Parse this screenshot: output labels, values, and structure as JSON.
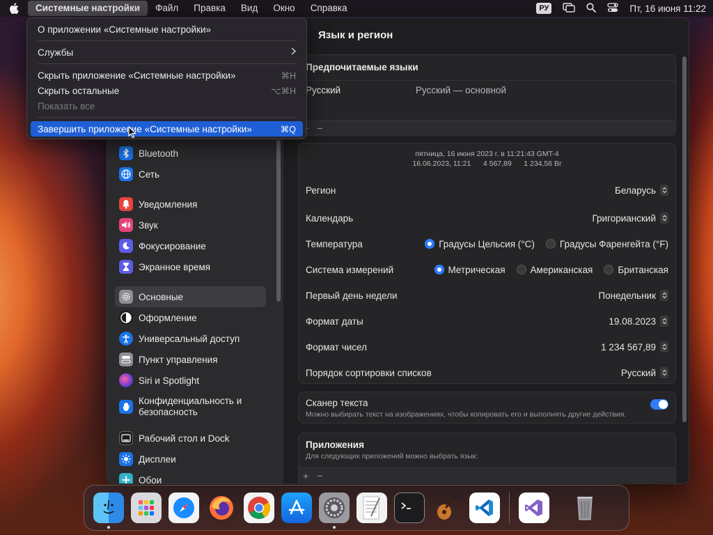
{
  "menubar": {
    "app_name": "Системные настройки",
    "items": [
      "Файл",
      "Правка",
      "Вид",
      "Окно",
      "Справка"
    ],
    "input_source": "РУ",
    "clock": "Пт, 16 июня  11:22"
  },
  "app_menu": {
    "about": "О приложении «Системные настройки»",
    "services": "Службы",
    "hide": "Скрыть приложение «Системные настройки»",
    "hide_shortcut": "⌘H",
    "hide_others": "Скрыть остальные",
    "hide_others_shortcut": "⌥⌘H",
    "show_all": "Показать все",
    "quit": "Завершить приложение «Системные настройки»",
    "quit_shortcut": "⌘Q"
  },
  "sidebar": {
    "items": [
      {
        "label": "Bluetooth",
        "icon": "bluetooth-icon",
        "color": "#1a73e8"
      },
      {
        "label": "Сеть",
        "icon": "globe-icon",
        "color": "#1a73e8"
      },
      {
        "label": "Уведомления",
        "icon": "bell-icon",
        "color": "#e5443f"
      },
      {
        "label": "Звук",
        "icon": "speaker-icon",
        "color": "#e5447a"
      },
      {
        "label": "Фокусирование",
        "icon": "moon-icon",
        "color": "#5e5ce6"
      },
      {
        "label": "Экранное время",
        "icon": "hourglass-icon",
        "color": "#5e5ce6"
      },
      {
        "label": "Основные",
        "icon": "gear-icon",
        "color": "#8e8e93"
      },
      {
        "label": "Оформление",
        "icon": "appearance-icon",
        "color": "#1c1c1e"
      },
      {
        "label": "Универсальный доступ",
        "icon": "accessibility-icon",
        "color": "#1a73e8"
      },
      {
        "label": "Пункт управления",
        "icon": "control-center-icon",
        "color": "#8e8e93"
      },
      {
        "label": "Siri и Spotlight",
        "icon": "siri-icon",
        "color": "#6b3fd4"
      },
      {
        "label": "Конфиденциальность и безопасность",
        "icon": "hand-icon",
        "color": "#1a73e8"
      },
      {
        "label": "Рабочий стол и Dock",
        "icon": "dock-icon",
        "color": "#1c1c1e"
      },
      {
        "label": "Дисплеи",
        "icon": "sun-icon",
        "color": "#1a73e8"
      },
      {
        "label": "Обои",
        "icon": "wallpaper-icon",
        "color": "#30b0c7"
      }
    ]
  },
  "content": {
    "title": "Язык и регион",
    "preferred_languages": {
      "title": "Предпочитаемые языки",
      "language": "Русский",
      "language_detail": "Русский — основной"
    },
    "preview": {
      "line1": "пятница, 16 июня 2023 г. в 11:21:43 GMT-4",
      "line2": "16.06.2023, 11:21      4 567,89      1 234,56 Br"
    },
    "region_label": "Регион",
    "region_value": "Беларусь",
    "calendar_label": "Календарь",
    "calendar_value": "Григорианский",
    "temperature_label": "Температура",
    "temperature_celsius": "Градусы Цельсия (°C)",
    "temperature_fahrenheit": "Градусы Фаренгейта (°F)",
    "measurement_label": "Система измерений",
    "measurement_metric": "Метрическая",
    "measurement_us": "Американская",
    "measurement_uk": "Британская",
    "first_day_label": "Первый день недели",
    "first_day_value": "Понедельник",
    "date_format_label": "Формат даты",
    "date_format_value": "19.08.2023",
    "number_format_label": "Формат чисел",
    "number_format_value": "1 234 567,89",
    "sort_label": "Порядок сортировки списков",
    "sort_value": "Русский",
    "live_text_label": "Сканер текста",
    "live_text_desc": "Можно выбирать текст на изображениях, чтобы копировать его и выполнять другие действия.",
    "apps_title": "Приложения",
    "apps_desc": "Для следующих приложений можно выбрать язык:",
    "plus": "+",
    "minus": "−"
  },
  "dock": {
    "apps": [
      "finder",
      "launchpad",
      "safari",
      "firefox",
      "chrome",
      "app-store",
      "system-settings",
      "textedit",
      "terminal",
      "garageband",
      "vscode",
      "visual-studio",
      "trash"
    ]
  }
}
